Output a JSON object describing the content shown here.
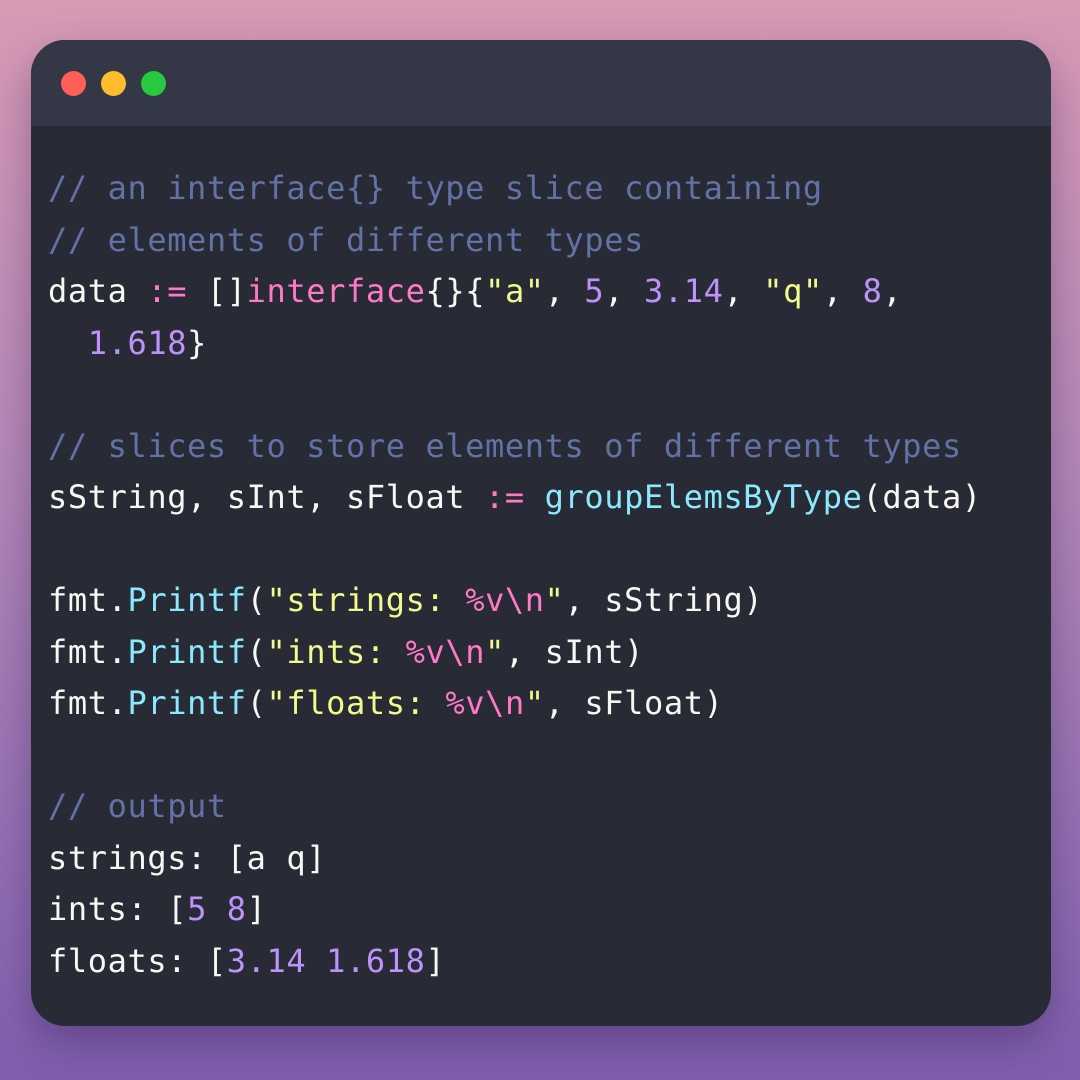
{
  "window": {
    "controls": [
      {
        "name": "close",
        "color": "#ff5f56"
      },
      {
        "name": "minimize",
        "color": "#ffbd2e"
      },
      {
        "name": "maximize",
        "color": "#27c93f"
      }
    ]
  },
  "colors": {
    "background_top": "#d89ab5",
    "background_bottom": "#7f5fae",
    "editor_bg": "#282a36",
    "titlebar_bg": "#343746",
    "comment": "#6272a4",
    "keyword": "#ff79c6",
    "string": "#f1fa8c",
    "number": "#bd93f9",
    "function": "#8be9fd",
    "text": "#f8f8f2"
  },
  "code": {
    "lines": [
      [
        {
          "t": "// an interface{} type slice containing",
          "c": "comment"
        }
      ],
      [
        {
          "t": "// elements of different types",
          "c": "comment"
        }
      ],
      [
        {
          "t": "data ",
          "c": "plain"
        },
        {
          "t": ":=",
          "c": "op"
        },
        {
          "t": " []",
          "c": "plain"
        },
        {
          "t": "interface",
          "c": "kw"
        },
        {
          "t": "{}{",
          "c": "plain"
        },
        {
          "t": "\"a\"",
          "c": "str"
        },
        {
          "t": ", ",
          "c": "plain"
        },
        {
          "t": "5",
          "c": "num"
        },
        {
          "t": ", ",
          "c": "plain"
        },
        {
          "t": "3.14",
          "c": "num"
        },
        {
          "t": ", ",
          "c": "plain"
        },
        {
          "t": "\"q\"",
          "c": "str"
        },
        {
          "t": ", ",
          "c": "plain"
        },
        {
          "t": "8",
          "c": "num"
        },
        {
          "t": ",",
          "c": "plain"
        }
      ],
      [
        {
          "t": "  ",
          "c": "plain"
        },
        {
          "t": "1.618",
          "c": "num"
        },
        {
          "t": "}",
          "c": "plain"
        }
      ],
      [],
      [
        {
          "t": "// slices to store elements of different types",
          "c": "comment"
        }
      ],
      [
        {
          "t": "sString, sInt, sFloat ",
          "c": "plain"
        },
        {
          "t": ":=",
          "c": "op"
        },
        {
          "t": " ",
          "c": "plain"
        },
        {
          "t": "groupElemsByType",
          "c": "fn"
        },
        {
          "t": "(data)",
          "c": "plain"
        }
      ],
      [],
      [
        {
          "t": "fmt.",
          "c": "plain"
        },
        {
          "t": "Printf",
          "c": "fn"
        },
        {
          "t": "(",
          "c": "plain"
        },
        {
          "t": "\"strings: ",
          "c": "str"
        },
        {
          "t": "%v\\n",
          "c": "kw"
        },
        {
          "t": "\"",
          "c": "str"
        },
        {
          "t": ", sString)",
          "c": "plain"
        }
      ],
      [
        {
          "t": "fmt.",
          "c": "plain"
        },
        {
          "t": "Printf",
          "c": "fn"
        },
        {
          "t": "(",
          "c": "plain"
        },
        {
          "t": "\"ints: ",
          "c": "str"
        },
        {
          "t": "%v\\n",
          "c": "kw"
        },
        {
          "t": "\"",
          "c": "str"
        },
        {
          "t": ", sInt)",
          "c": "plain"
        }
      ],
      [
        {
          "t": "fmt.",
          "c": "plain"
        },
        {
          "t": "Printf",
          "c": "fn"
        },
        {
          "t": "(",
          "c": "plain"
        },
        {
          "t": "\"floats: ",
          "c": "str"
        },
        {
          "t": "%v\\n",
          "c": "kw"
        },
        {
          "t": "\"",
          "c": "str"
        },
        {
          "t": ", sFloat)",
          "c": "plain"
        }
      ],
      [],
      [
        {
          "t": "// output",
          "c": "comment"
        }
      ],
      [
        {
          "t": "strings: [a q]",
          "c": "plain"
        }
      ],
      [
        {
          "t": "ints: [",
          "c": "plain"
        },
        {
          "t": "5 8",
          "c": "num"
        },
        {
          "t": "]",
          "c": "plain"
        }
      ],
      [
        {
          "t": "floats: [",
          "c": "plain"
        },
        {
          "t": "3.14 1.618",
          "c": "num"
        },
        {
          "t": "]",
          "c": "plain"
        }
      ]
    ]
  }
}
